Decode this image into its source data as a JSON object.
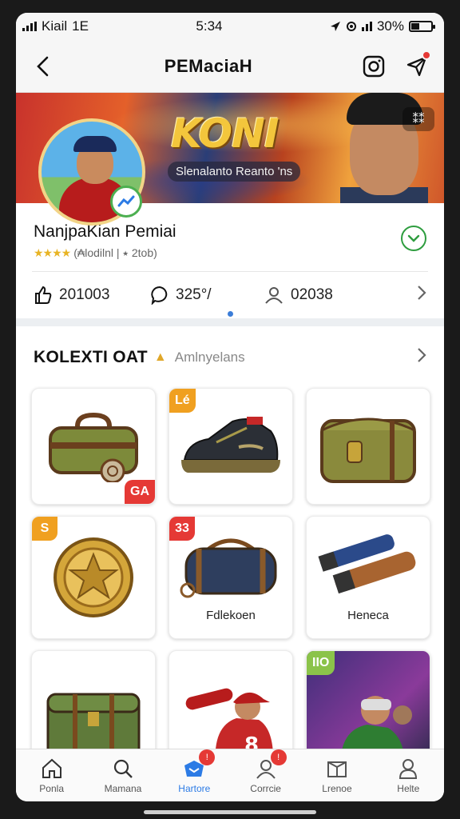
{
  "status_bar": {
    "carrier": "Kiail",
    "network": "1E",
    "time": "5:34",
    "battery": "30%"
  },
  "header": {
    "title": "PEMaciaH",
    "back_icon": "back-arrow-icon",
    "instagram_icon": "camera-icon",
    "send_icon": "send-icon"
  },
  "banner": {
    "logo": "KONI",
    "tagline": "Slenalanto Reanto 'ns",
    "menu": "⁑⁑"
  },
  "profile": {
    "name": "NanjpaKian Pemiai",
    "stars": "★★★★",
    "rating_text": "(₳lodilnl | ⭑ 2tob)"
  },
  "stats": {
    "likes": "201003",
    "comments": "325°/",
    "followers": "02038"
  },
  "collection": {
    "title": "KOLEXTI OAT",
    "subtitle": "Amlnyelans",
    "items": [
      {
        "label": "",
        "badge": "GA",
        "badge_pos": "br",
        "badge_color": "red",
        "art": "bag"
      },
      {
        "label": "",
        "badge": "Lé",
        "badge_pos": "tl",
        "badge_color": "orange",
        "art": "shoe"
      },
      {
        "label": "",
        "badge": "",
        "badge_pos": "",
        "badge_color": "",
        "art": "pouch"
      },
      {
        "label": "",
        "badge": "S",
        "badge_pos": "tl",
        "badge_color": "orange",
        "art": "medal"
      },
      {
        "label": "Fdlekoen",
        "badge": "33",
        "badge_pos": "tl",
        "badge_color": "red",
        "art": "duffel"
      },
      {
        "label": "Heneca",
        "badge": "",
        "badge_pos": "",
        "badge_color": "",
        "art": "tubes"
      },
      {
        "label": "",
        "badge": "",
        "badge_pos": "",
        "badge_color": "",
        "art": "trunk"
      },
      {
        "label": "",
        "badge": "",
        "badge_pos": "",
        "badge_color": "",
        "art": "player"
      },
      {
        "label": "",
        "badge": "IIO",
        "badge_pos": "tl",
        "badge_color": "green",
        "art": "cricket"
      }
    ]
  },
  "bottom_nav": {
    "tabs": [
      {
        "label": "Ponla",
        "icon": "home-icon",
        "badge": ""
      },
      {
        "label": "Mamana",
        "icon": "search-icon",
        "badge": ""
      },
      {
        "label": "Hartore",
        "icon": "store-icon",
        "badge": "!"
      },
      {
        "label": "Corrcie",
        "icon": "profile-icon",
        "badge": "!"
      },
      {
        "label": "Lrenoe",
        "icon": "box-icon",
        "badge": ""
      },
      {
        "label": "Helte",
        "icon": "user-icon",
        "badge": ""
      }
    ],
    "active_index": 2
  },
  "colors": {
    "accent": "#2c7be5",
    "badge_red": "#e53935",
    "badge_orange": "#f0a020",
    "verified_green": "#2e9d3f",
    "star": "#e8b425"
  }
}
